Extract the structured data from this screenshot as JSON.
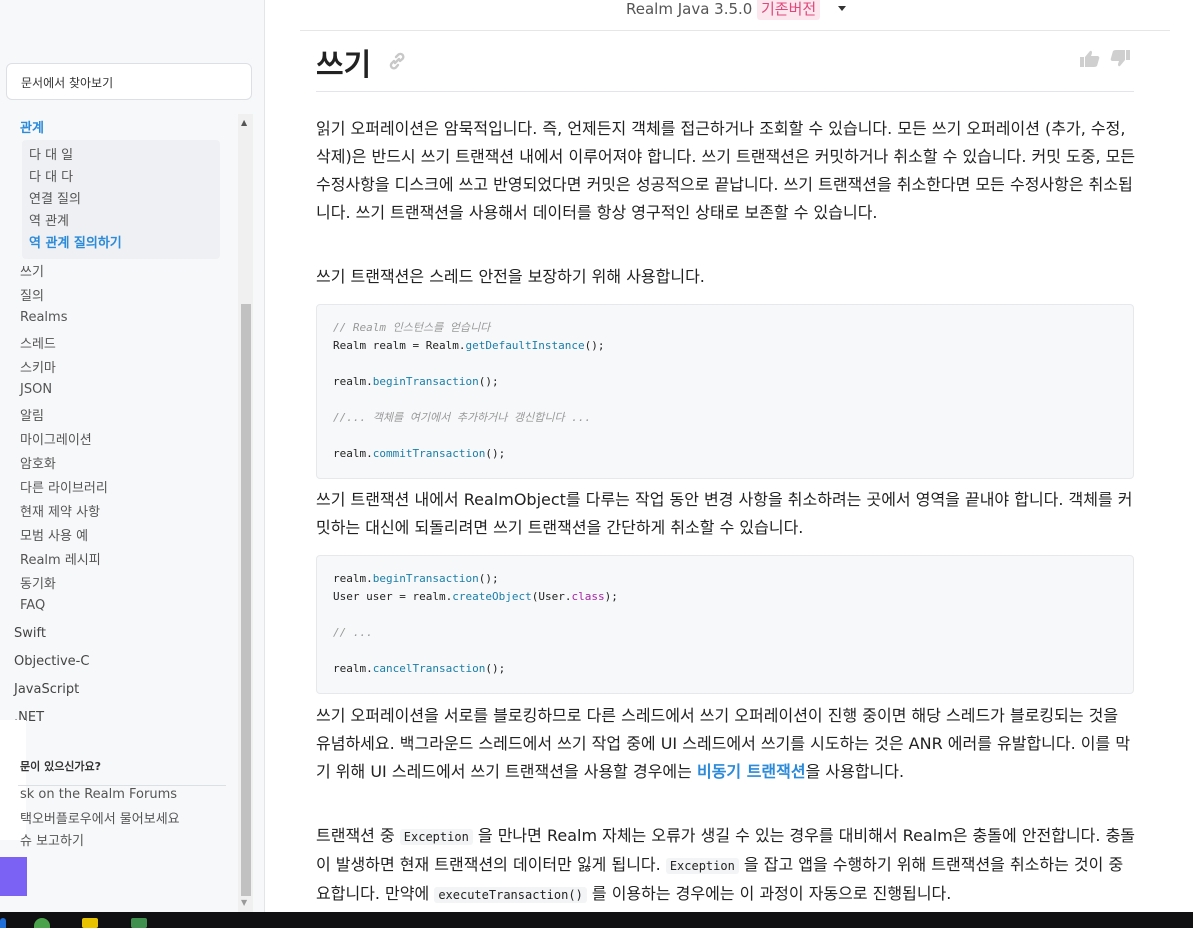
{
  "sidebar": {
    "search_placeholder": "문서에서 찾아보기",
    "active_category": "관계",
    "sub_items": [
      "다 대 일",
      "다 대 다",
      "연결 질의",
      "역 관계",
      "역 관계 질의하기"
    ],
    "items": [
      "쓰기",
      "질의",
      "Realms",
      "스레드",
      "스키마",
      "JSON",
      "알림",
      "마이그레이션",
      "암호화",
      "다른 라이브러리",
      "현재 제약 사항",
      "모범 사용 예",
      "Realm 레시피",
      "동기화",
      "FAQ"
    ],
    "languages": [
      "Swift",
      "Objective-C",
      "JavaScript",
      ".NET"
    ],
    "help": {
      "title": "문이 있으신가요?",
      "links": [
        "sk on the Realm Forums",
        "택오버플로우에서 물어보세요",
        "슈 보고하기"
      ]
    }
  },
  "header": {
    "version": "Realm Java 3.5.0",
    "version_tag": "기존버전"
  },
  "page": {
    "title": "쓰기",
    "para1": "읽기 오퍼레이션은 암묵적입니다. 즉, 언제든지 객체를 접근하거나 조회할 수 있습니다. 모든 쓰기 오퍼레이션 (추가, 수정, 삭제)은 반드시 쓰기 트랜잭션 내에서 이루어져야 합니다. 쓰기 트랜잭션은 커밋하거나 취소할 수 있습니다. 커밋 도중, 모든 수정사항을 디스크에 쓰고 반영되었다면 커밋은 성공적으로 끝납니다. 쓰기 트랜잭션을 취소한다면 모든 수정사항은 취소됩니다. 쓰기 트랜잭션을 사용해서 데이터를 항상 영구적인 상태로 보존할 수 있습니다.",
    "para2": "쓰기 트랜잭션은 스레드 안전을 보장하기 위해 사용합니다.",
    "code1": {
      "comment1": "// Realm 인스턴스를 얻습니다",
      "l2a": "Realm realm = Realm.",
      "l2fn": "getDefaultInstance",
      "l2b": "();",
      "l3a": "realm.",
      "l3fn": "beginTransaction",
      "l3b": "();",
      "comment2": "//... 객체를 여기에서 추가하거나 갱신합니다 ...",
      "l5a": "realm.",
      "l5fn": "commitTransaction",
      "l5b": "();"
    },
    "para3": "쓰기 트랜잭션 내에서 RealmObject를 다루는 작업 동안 변경 사항을 취소하려는 곳에서 영역을 끝내야 합니다. 객체를 커밋하는 대신에 되돌리려면 쓰기 트랜잭션을 간단하게 취소할 수 있습니다.",
    "code2": {
      "l1a": "realm.",
      "l1fn": "beginTransaction",
      "l1b": "();",
      "l2a": "User user = realm.",
      "l2fn": "createObject",
      "l2b": "(User.",
      "l2kw": "class",
      "l2c": ");",
      "comment": "// ...",
      "l4a": "realm.",
      "l4fn": "cancelTransaction",
      "l4b": "();"
    },
    "para4_pre": "쓰기 오퍼레이션을 서로를 블로킹하므로 다른 스레드에서 쓰기 오퍼레이션이 진행 중이면 해당 스레드가 블로킹되는 것을 유념하세요. 백그라운드 스레드에서 쓰기 작업 중에 UI 스레드에서 쓰기를 시도하는 것은 ANR 에러를 유발합니다. 이를 막기 위해 UI 스레드에서 쓰기 트랜잭션을 사용할 경우에는 ",
    "para4_link": "비동기 트랜잭션",
    "para4_post": "을 사용합니다.",
    "para5_a": "트랜잭션 중 ",
    "para5_code1": "Exception",
    "para5_b": " 을 만나면 Realm 자체는 오류가 생길 수 있는 경우를 대비해서 Realm은 충돌에 안전합니다. 충돌이 발생하면 현재 트랜잭션의 데이터만 잃게 됩니다. ",
    "para5_code2": "Exception",
    "para5_c": " 을 잡고 앱을 수행하기 위해 트랜잭션을 취소하는 것이 중요합니다. 만약에 ",
    "para5_code3": "executeTransaction()",
    "para5_d": " 를 이용하는 경우에는 이 과정이 자동으로 진행됩니다."
  },
  "colors": {
    "accent": "#2b8ad9",
    "tag": "#e0487c",
    "purple": "#7b62f5"
  }
}
